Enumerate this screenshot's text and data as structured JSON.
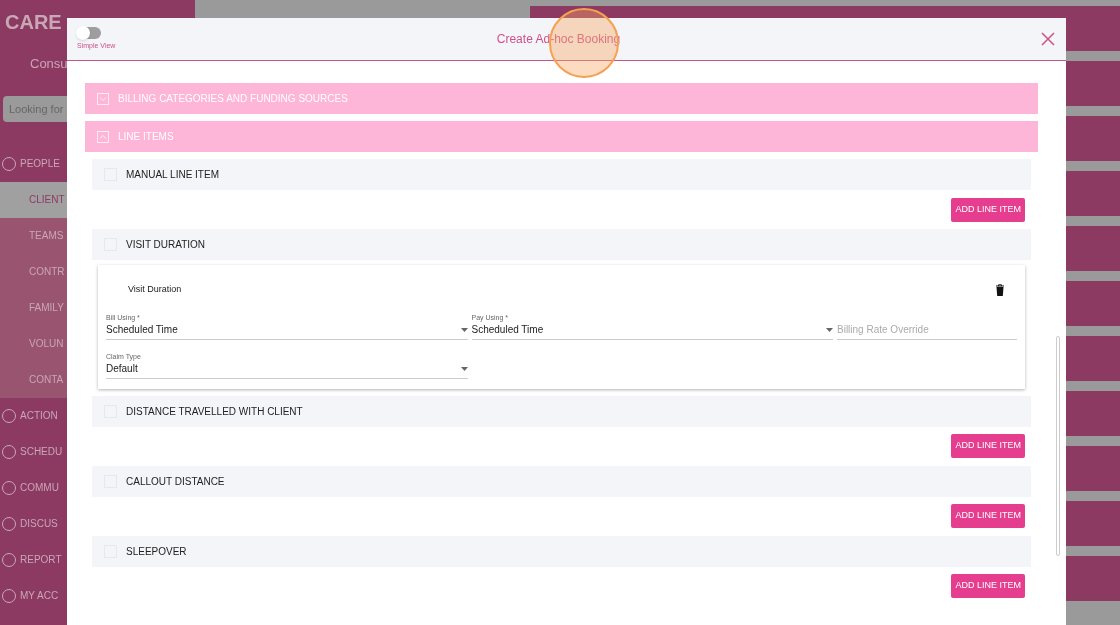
{
  "sidebar": {
    "logo": "CARE",
    "subtitle": "Consu",
    "search": {
      "placeholder": "Looking for"
    },
    "items": [
      {
        "label": "PEOPLE",
        "kind": "icon",
        "selected": false
      },
      {
        "label": "CLIENT",
        "kind": "sub",
        "selected": true
      },
      {
        "label": "TEAMS",
        "kind": "sub",
        "selected": false
      },
      {
        "label": "CONTR",
        "kind": "sub",
        "selected": false
      },
      {
        "label": "FAMILY",
        "kind": "sub",
        "selected": false
      },
      {
        "label": "VOLUN",
        "kind": "sub",
        "selected": false
      },
      {
        "label": "CONTA",
        "kind": "sub",
        "selected": false
      },
      {
        "label": "ACTION",
        "kind": "icon",
        "selected": false
      },
      {
        "label": "SCHEDU",
        "kind": "icon",
        "selected": false
      },
      {
        "label": "COMMU",
        "kind": "icon",
        "selected": false
      },
      {
        "label": "DISCUS",
        "kind": "icon",
        "selected": false
      },
      {
        "label": "REPORT",
        "kind": "icon",
        "selected": false
      },
      {
        "label": "MY ACC",
        "kind": "icon",
        "selected": false
      }
    ]
  },
  "modal": {
    "title": "Create Ad-hoc Booking",
    "simple_view": {
      "label": "Simple View",
      "on": false
    },
    "sections": [
      {
        "title": "BILLING CATEGORIES AND FUNDING SOURCES",
        "expanded": false
      },
      {
        "title": "LINE ITEMS",
        "expanded": true
      }
    ],
    "line_items": [
      {
        "name": "MANUAL LINE ITEM",
        "checked": false,
        "kind": "button",
        "button": "ADD LINE ITEM"
      },
      {
        "name": "VISIT DURATION",
        "checked": false,
        "kind": "card",
        "card": {
          "title": "Visit Duration",
          "fields": [
            {
              "kind": "select",
              "label": "Bill Using *",
              "value": "Scheduled Time"
            },
            {
              "kind": "select",
              "label": "Pay Using *",
              "value": "Scheduled Time"
            },
            {
              "kind": "text",
              "placeholder": "Billing Rate Override"
            },
            {
              "kind": "select",
              "label": "Claim Type",
              "value": "Default"
            }
          ]
        }
      },
      {
        "name": "DISTANCE TRAVELLED WITH CLIENT",
        "checked": false,
        "kind": "button",
        "button": "ADD LINE ITEM"
      },
      {
        "name": "CALLOUT DISTANCE",
        "checked": false,
        "kind": "button",
        "button": "ADD LINE ITEM"
      },
      {
        "name": "SLEEPOVER",
        "checked": false,
        "kind": "button",
        "button": "ADD LINE ITEM"
      }
    ]
  }
}
